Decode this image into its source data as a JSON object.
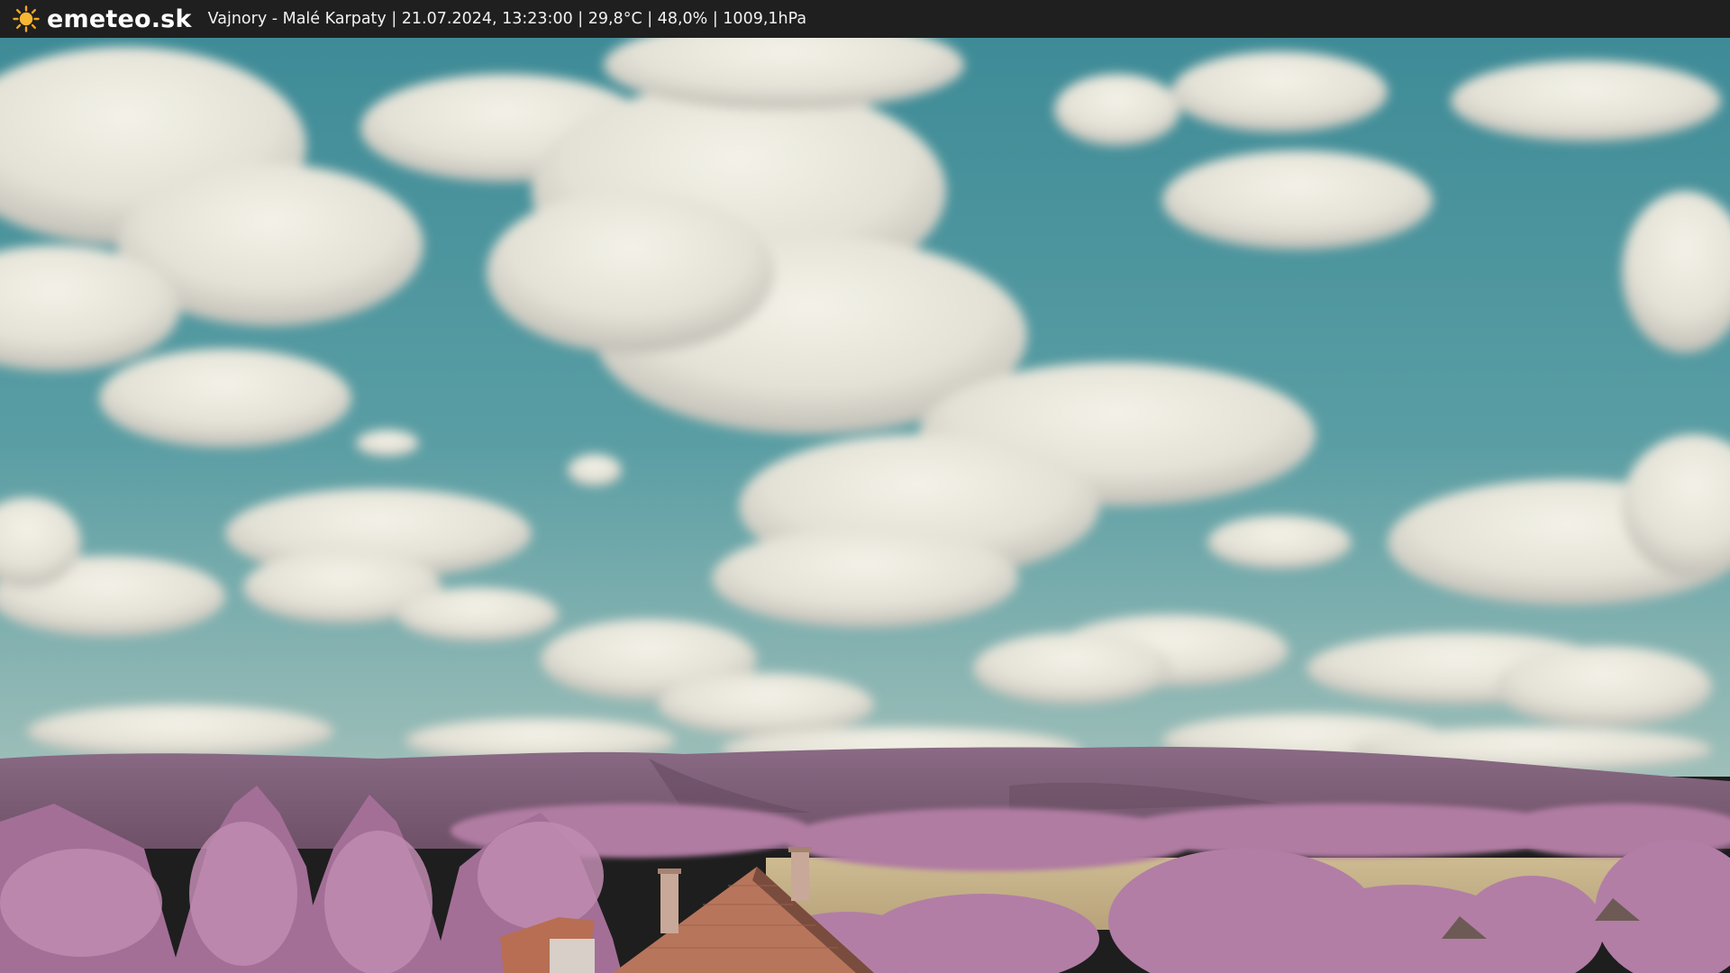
{
  "header": {
    "logo_icon": "sun-icon",
    "site_name": "emeteo.sk",
    "caption": "Vajnory - Malé Karpaty | 21.07.2024, 13:23:00 | 29,8°C | 48,0% | 1009,1hPa"
  },
  "scene": {
    "description_icon": "webcam-image",
    "colors": {
      "sky_top": "#3f8f9a",
      "sky_bottom": "#8fb6b3",
      "cloud": "#ecebe0",
      "cloud_shadow": "#b7b4ad",
      "hills": "#7e5f78",
      "trees": "#b57fa6",
      "field": "#c9b58c",
      "roof": "#b97358",
      "bar": "#1f1f1f"
    }
  }
}
